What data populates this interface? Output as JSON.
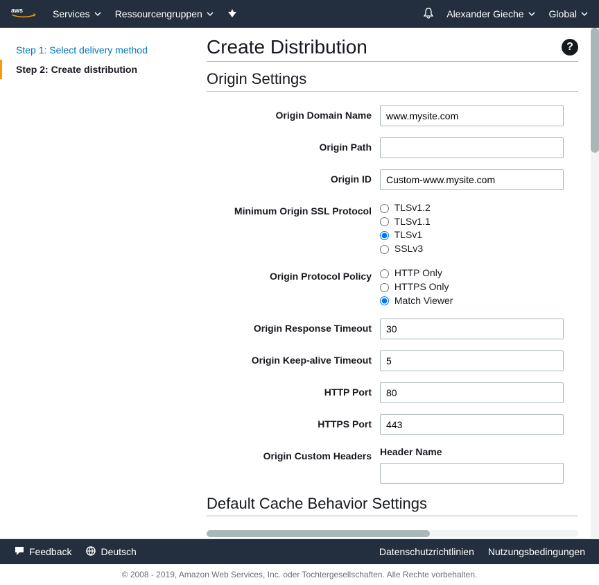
{
  "topnav": {
    "services": "Services",
    "resource_groups": "Ressourcengruppen",
    "user": "Alexander Gieche",
    "region": "Global"
  },
  "sidebar": {
    "step1": "Step 1: Select delivery method",
    "step2": "Step 2: Create distribution"
  },
  "page": {
    "title": "Create Distribution",
    "section_origin": "Origin Settings",
    "section_cache": "Default Cache Behavior Settings"
  },
  "labels": {
    "origin_domain_name": "Origin Domain Name",
    "origin_path": "Origin Path",
    "origin_id": "Origin ID",
    "min_ssl": "Minimum Origin SSL Protocol",
    "protocol_policy": "Origin Protocol Policy",
    "response_timeout": "Origin Response Timeout",
    "keepalive_timeout": "Origin Keep-alive Timeout",
    "http_port": "HTTP Port",
    "https_port": "HTTPS Port",
    "custom_headers": "Origin Custom Headers",
    "header_name": "Header Name"
  },
  "values": {
    "origin_domain_name": "www.mysite.com",
    "origin_path": "",
    "origin_id": "Custom-www.mysite.com",
    "response_timeout": "30",
    "keepalive_timeout": "5",
    "http_port": "80",
    "https_port": "443"
  },
  "ssl_options": {
    "tls12": "TLSv1.2",
    "tls11": "TLSv1.1",
    "tls1": "TLSv1",
    "ssl3": "SSLv3"
  },
  "protocol_options": {
    "http": "HTTP Only",
    "https": "HTTPS Only",
    "match": "Match Viewer"
  },
  "footer": {
    "feedback": "Feedback",
    "language": "Deutsch",
    "privacy": "Datenschutzrichtlinien",
    "terms": "Nutzungsbedingungen",
    "copyright": "© 2008 - 2019, Amazon Web Services, Inc. oder Tochtergesellschaften. Alle Rechte vorbehalten."
  }
}
